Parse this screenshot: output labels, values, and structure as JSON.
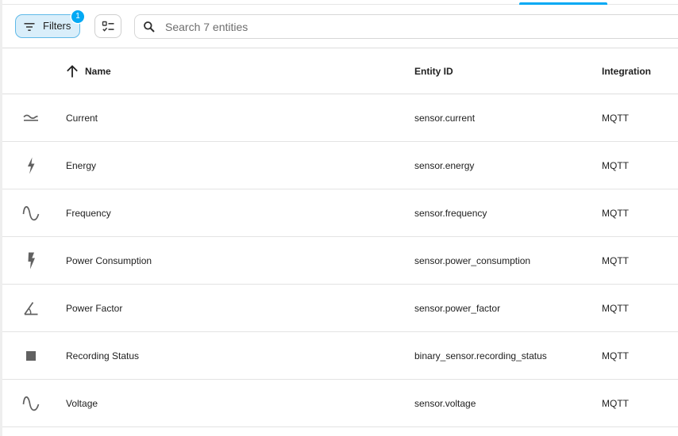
{
  "toolbar": {
    "filters_label": "Filters",
    "filters_badge": "1",
    "search_placeholder": "Search 7 entities",
    "search_value": ""
  },
  "table": {
    "columns": {
      "name": "Name",
      "entity_id": "Entity ID",
      "integration": "Integration"
    },
    "sort_column": "name",
    "sort_direction": "ascending",
    "rows": [
      {
        "icon": "current-ac-icon",
        "name": "Current",
        "entity_id": "sensor.current",
        "integration": "MQTT"
      },
      {
        "icon": "lightning-bolt-icon",
        "name": "Energy",
        "entity_id": "sensor.energy",
        "integration": "MQTT"
      },
      {
        "icon": "sine-wave-icon",
        "name": "Frequency",
        "entity_id": "sensor.frequency",
        "integration": "MQTT"
      },
      {
        "icon": "flash-icon",
        "name": "Power Consumption",
        "entity_id": "sensor.power_consumption",
        "integration": "MQTT"
      },
      {
        "icon": "angle-acute-icon",
        "name": "Power Factor",
        "entity_id": "sensor.power_factor",
        "integration": "MQTT"
      },
      {
        "icon": "stop-square-icon",
        "name": "Recording Status",
        "entity_id": "binary_sensor.recording_status",
        "integration": "MQTT"
      },
      {
        "icon": "sine-wave-icon",
        "name": "Voltage",
        "entity_id": "sensor.voltage",
        "integration": "MQTT"
      }
    ]
  },
  "colors": {
    "accent": "#03a9f4",
    "filters_bg": "#d9eefa",
    "icon_gray": "#616161",
    "divider": "#e3e3e3"
  }
}
